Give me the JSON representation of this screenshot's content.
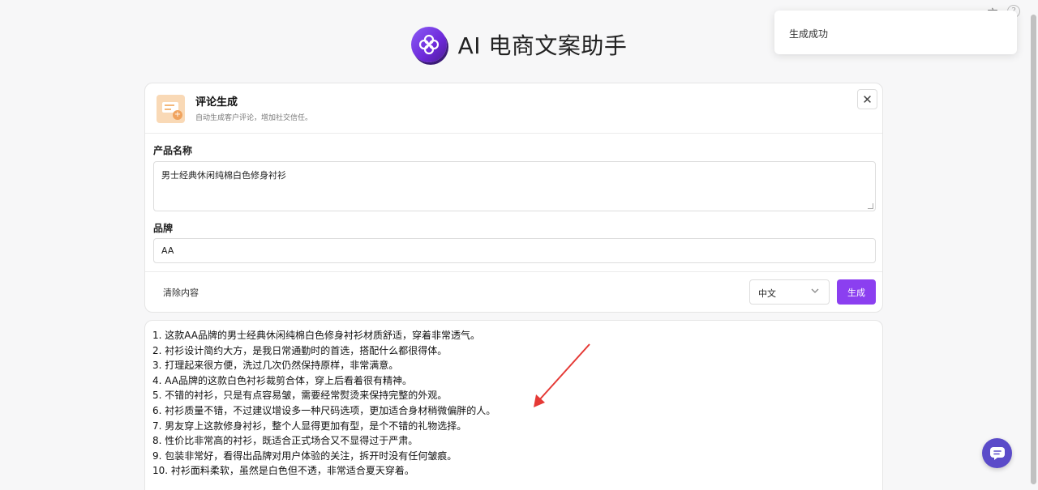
{
  "header": {
    "title": "AI 电商文案助手"
  },
  "toast": {
    "message": "生成成功"
  },
  "top_icons": {
    "translate": "文",
    "help": "?"
  },
  "tool": {
    "title": "评论生成",
    "description": "自动生成客户评论，增加社交信任。",
    "close": "✕"
  },
  "form": {
    "product_label": "产品名称",
    "product_value": "男士经典休闲纯棉白色修身衬衫",
    "brand_label": "品牌",
    "brand_value": "AA",
    "clear_label": "清除内容",
    "language_value": "中文",
    "generate_label": "生成"
  },
  "result": {
    "lines": [
      "1. 这款AA品牌的男士经典休闲纯棉白色修身衬衫材质舒适，穿着非常透气。",
      "2. 衬衫设计简约大方，是我日常通勤时的首选，搭配什么都很得体。",
      "3. 打理起来很方便，洗过几次仍然保持原样，非常满意。",
      "4. AA品牌的这款白色衬衫裁剪合体，穿上后看着很有精神。",
      "5. 不错的衬衫，只是有点容易皱，需要经常熨烫来保持完整的外观。",
      "6. 衬衫质量不错，不过建议增设多一种尺码选项，更加适合身材稍微偏胖的人。",
      "7. 男友穿上这款修身衬衫，整个人显得更加有型，是个不错的礼物选择。",
      "8. 性价比非常高的衬衫，既适合正式场合又不显得过于严肃。",
      "9. 包装非常好，看得出品牌对用户体验的关注，拆开时没有任何皱痕。",
      "10. 衬衫面料柔软，虽然是白色但不透，非常适合夏天穿着。"
    ]
  },
  "colors": {
    "accent": "#8b3ff0",
    "chat": "#5b4bc9",
    "arrow": "#e53935"
  }
}
